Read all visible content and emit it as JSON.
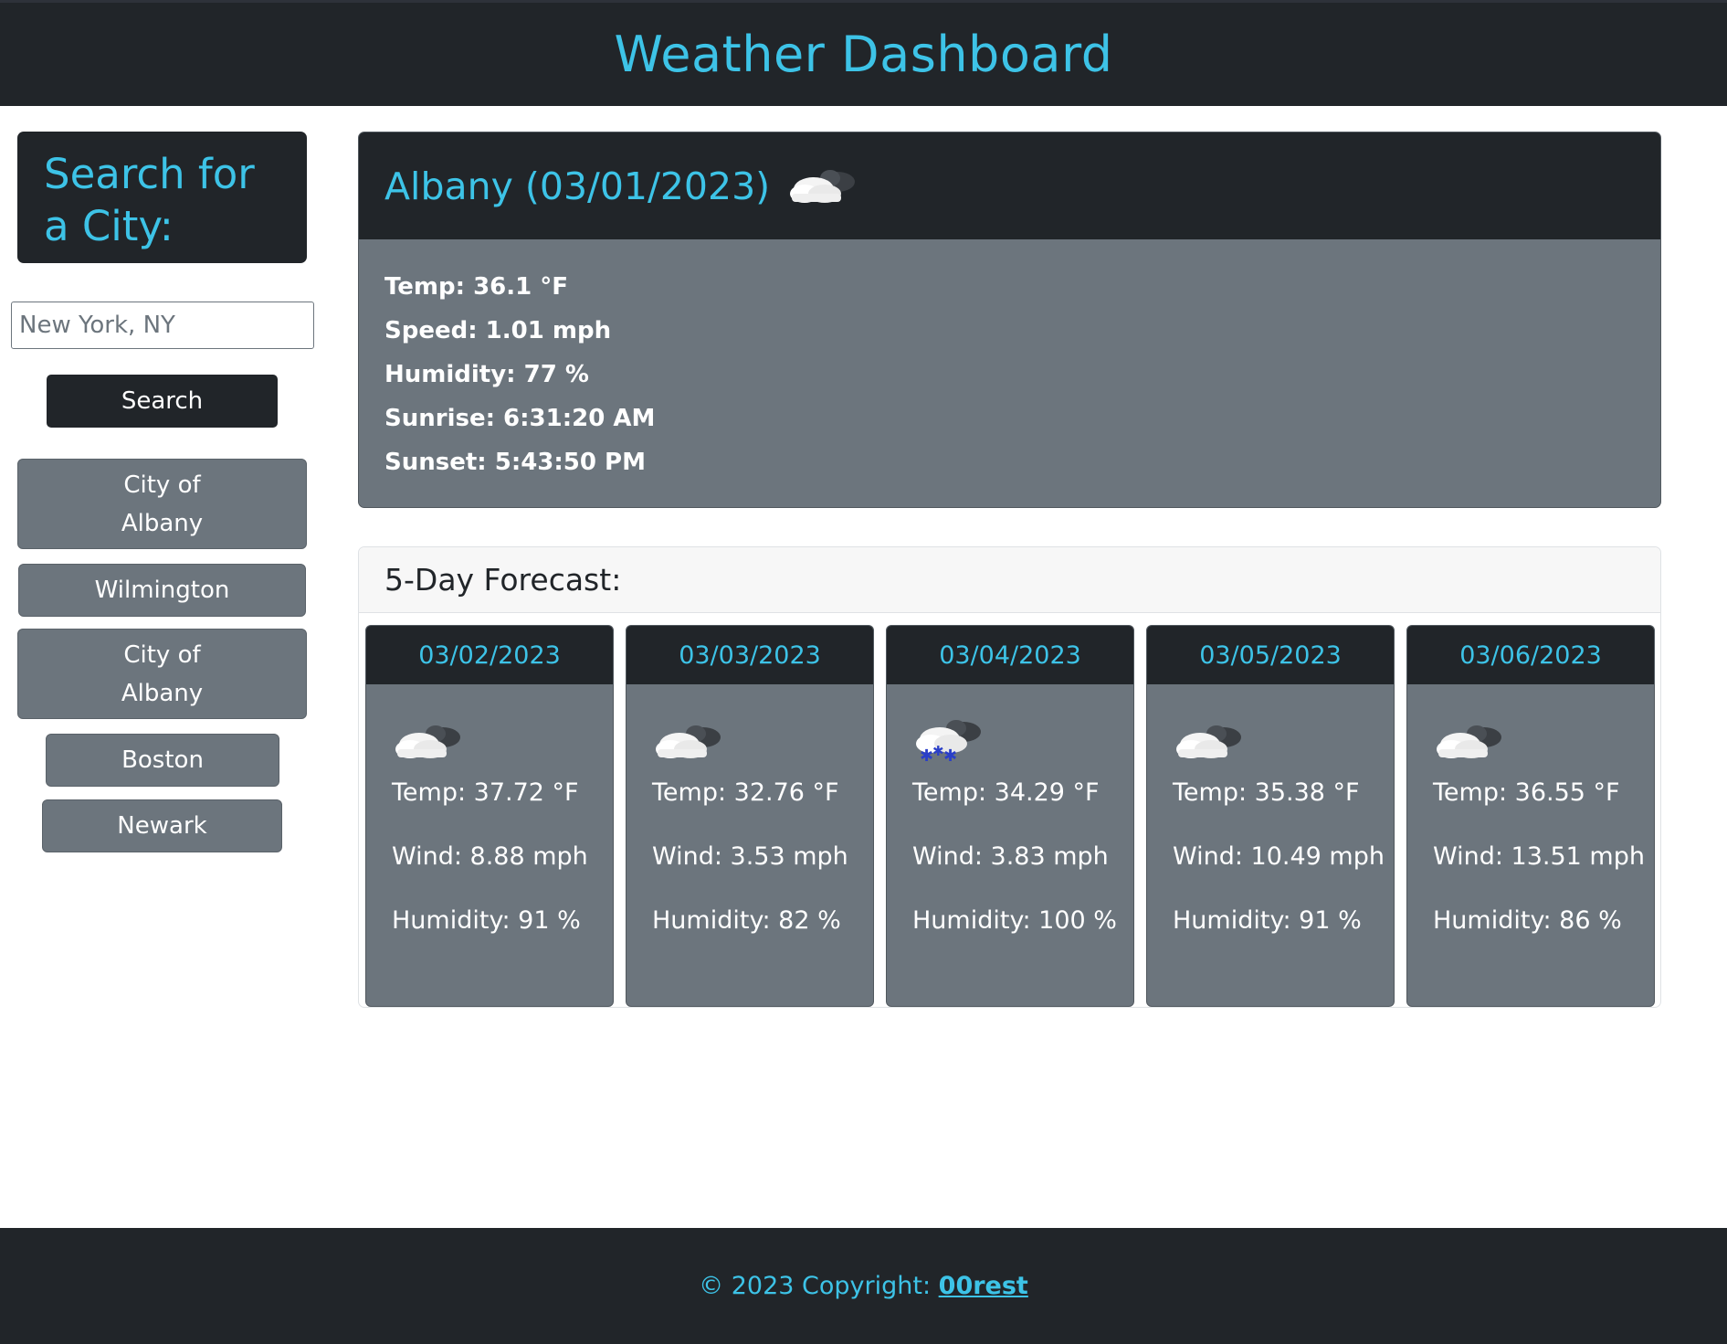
{
  "header": {
    "title": "Weather Dashboard"
  },
  "sidebar": {
    "heading": "Search for a City:",
    "input": {
      "value": "",
      "placeholder": "New York, NY"
    },
    "search_label": "Search",
    "history": [
      {
        "label_lines": [
          "City of",
          "Albany"
        ]
      },
      {
        "label_lines": [
          "Wilmington"
        ]
      },
      {
        "label_lines": [
          "City of",
          "Albany"
        ]
      },
      {
        "label_lines": [
          "Boston"
        ]
      },
      {
        "label_lines": [
          "Newark"
        ]
      }
    ]
  },
  "current": {
    "title": "Albany (03/01/2023)",
    "icon": "cloudy-icon",
    "temp": "Temp: 36.1 °F",
    "speed": "Speed: 1.01 mph",
    "humidity": "Humidity: 77 %",
    "sunrise": "Sunrise: 6:31:20 AM",
    "sunset": "Sunset: 5:43:50 PM"
  },
  "forecast": {
    "heading": "5-Day Forecast:",
    "days": [
      {
        "date": "03/02/2023",
        "icon": "cloudy-icon",
        "temp": "Temp: 37.72 °F",
        "wind": "Wind: 8.88 mph",
        "humidity": "Humidity: 91 %"
      },
      {
        "date": "03/03/2023",
        "icon": "cloudy-icon",
        "temp": "Temp: 32.76 °F",
        "wind": "Wind: 3.53 mph",
        "humidity": "Humidity: 82 %"
      },
      {
        "date": "03/04/2023",
        "icon": "snow-icon",
        "temp": "Temp: 34.29 °F",
        "wind": "Wind: 3.83 mph",
        "humidity": "Humidity: 100 %"
      },
      {
        "date": "03/05/2023",
        "icon": "cloudy-icon",
        "temp": "Temp: 35.38 °F",
        "wind": "Wind: 10.49 mph",
        "humidity": "Humidity: 91 %"
      },
      {
        "date": "03/06/2023",
        "icon": "cloudy-icon",
        "temp": "Temp: 36.55 °F",
        "wind": "Wind: 13.51 mph",
        "humidity": "Humidity: 86 %"
      }
    ]
  },
  "footer": {
    "prefix": "© 2023 Copyright: ",
    "link": "00rest"
  },
  "colors": {
    "accent": "#3dc3e7",
    "dark": "#212529",
    "gray": "#6c757d"
  }
}
